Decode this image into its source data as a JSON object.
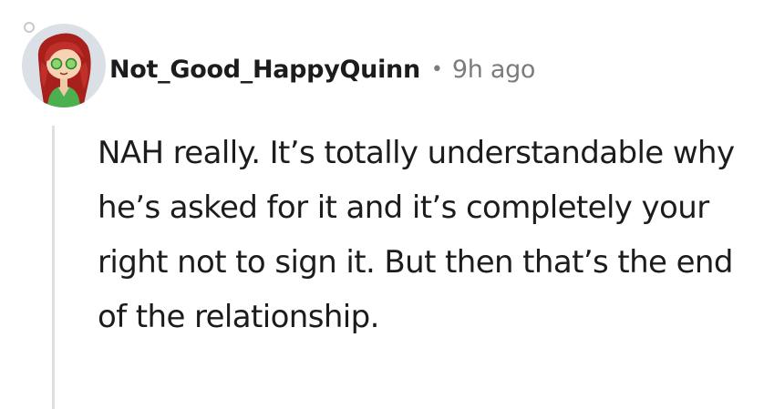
{
  "comment": {
    "author": "Not_Good_HappyQuinn",
    "separator": "•",
    "timestamp": "9h ago",
    "avatar_icon": "snoo-avatar-icon",
    "body": "NAH really. It’s totally understandable why he’s asked for it and it’s completely your right not to sign it. But then that’s the end of the relationship."
  },
  "colors": {
    "text": "#1c1c1c",
    "meta": "#7c7c7c",
    "thread_line": "#e0e0e0",
    "avatar_bg": "#dae0e6",
    "hair": "#b5241f",
    "outfit": "#4caf50"
  }
}
